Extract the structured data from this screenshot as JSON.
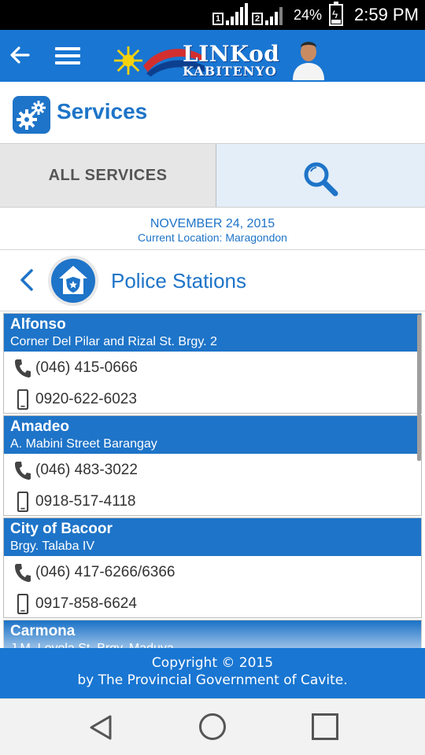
{
  "status_bar": {
    "sim1": "1",
    "sim2": "2",
    "battery": "24%",
    "time": "2:59 PM"
  },
  "app_bar": {
    "logo_line1": "LINKod",
    "logo_line2": "KABITENYO"
  },
  "services": {
    "title": "Services"
  },
  "tabs": {
    "all_services": "ALL SERVICES"
  },
  "date_info": {
    "date": "NOVEMBER 24, 2015",
    "location": "Current Location: Maragondon"
  },
  "category": {
    "title": "Police Stations"
  },
  "stations": [
    {
      "name": "Alfonso",
      "address": "Corner Del Pilar and Rizal St. Brgy. 2",
      "phone": "(046) 415-0666",
      "mobile": "0920-622-6023"
    },
    {
      "name": "Amadeo",
      "address": "A. Mabini Street Barangay",
      "phone": "(046) 483-3022",
      "mobile": "0918-517-4118"
    },
    {
      "name": "City of Bacoor",
      "address": "Brgy. Talaba IV",
      "phone": "(046) 417-6266/6366",
      "mobile": "0917-858-6624"
    },
    {
      "name": "Carmona",
      "address": "J.M. Loyola St. Brgy. Maduya",
      "phone": "",
      "mobile": ""
    }
  ],
  "footer": {
    "line1": "Copyright © 2015",
    "line2": "by The Provincial Government of Cavite."
  },
  "colors": {
    "primary": "#1976d2",
    "accent": "#1e74c8"
  },
  "icons": [
    "back-arrow-icon",
    "menu-icon",
    "gears-icon",
    "search-icon",
    "police-badge-icon",
    "phone-icon",
    "mobile-phone-icon"
  ]
}
